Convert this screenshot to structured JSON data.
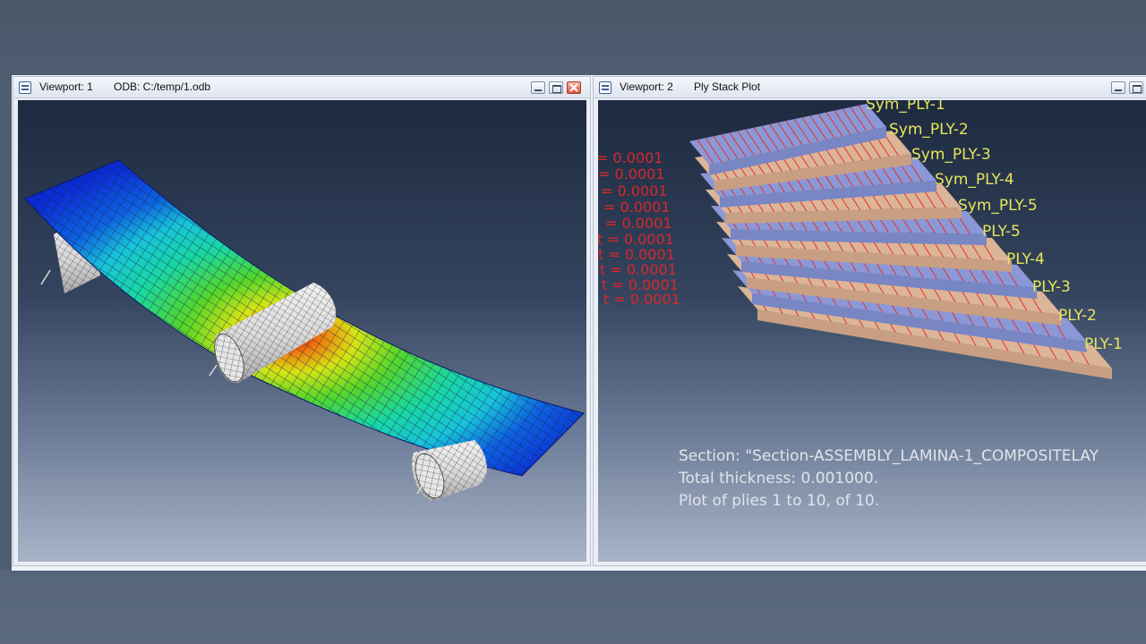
{
  "viewport1": {
    "title": "Viewport: 1",
    "odb": "ODB: C:/temp/1.odb"
  },
  "viewport2": {
    "title": "Viewport: 2",
    "subtitle": "Ply Stack Plot",
    "ply_labels": [
      "Sym_PLY-1",
      "Sym_PLY-2",
      "Sym_PLY-3",
      "Sym_PLY-4",
      "Sym_PLY-5",
      "PLY-5",
      "PLY-4",
      "PLY-3",
      "PLY-2",
      "PLY-1"
    ],
    "thickness_labels": [
      "= 0.0001",
      "= 0.0001",
      "= 0.0001",
      "= 0.0001",
      "= 0.0001",
      "t = 0.0001",
      "t = 0.0001",
      "t = 0.0001",
      "t = 0.0001",
      "t = 0.0001"
    ],
    "section_line": "Section: \"Section-ASSEMBLY_LAMINA-1_COMPOSITELAY",
    "thickness_line": "Total thickness: 0.001000.",
    "plies_line": "Plot of plies 1 to 10, of 10."
  },
  "colors": {
    "ply_blue": "#8a98d8",
    "ply_tan": "#dcb497",
    "hatch": "#e2342c",
    "label_yellow": "#e7e55a",
    "contour_blue": "#0b2bd6"
  },
  "icons": {
    "viewport": "viewport-icon",
    "minimize": "minimize-icon",
    "restore": "restore-icon",
    "close": "close-icon"
  }
}
